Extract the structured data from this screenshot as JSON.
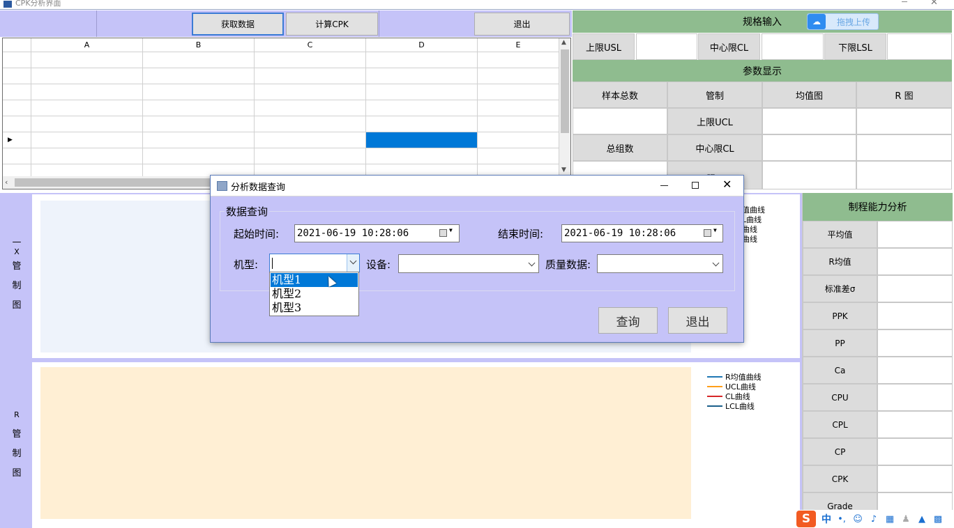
{
  "window": {
    "title": "CPK分析界面"
  },
  "toolbar": {
    "get_data": "获取数据",
    "calc_cpk": "计算CPK",
    "exit": "退出"
  },
  "grid": {
    "columns": [
      "A",
      "B",
      "C",
      "D",
      "E"
    ],
    "row_marker": "▸"
  },
  "spec": {
    "title": "规格输入",
    "upload": "拖拽上传",
    "usl": "上限USL",
    "cl": "中心限CL",
    "lsl": "下限LSL"
  },
  "params": {
    "title": "参数显示",
    "sample_total": "样本总数",
    "control": "管制",
    "mean_chart": "均值图",
    "r_chart": "R 图",
    "ucl": "上限UCL",
    "total_groups": "总组数",
    "cl": "中心限CL",
    "lcl": "下限LCL"
  },
  "capability": {
    "title": "制程能力分析",
    "items": [
      "平均值",
      "R均值",
      "标准差σ",
      "PPK",
      "PP",
      "Ca",
      "CPU",
      "CPL",
      "CP",
      "CPK",
      "Grade"
    ]
  },
  "xchart": {
    "label_chars": [
      "—",
      "X",
      "管",
      "制",
      "图"
    ],
    "legend": [
      "值曲线",
      "L曲线",
      "曲线",
      "曲线"
    ]
  },
  "rchart": {
    "label_chars": [
      "R",
      "管",
      "制",
      "图"
    ],
    "legend": [
      "R均值曲线",
      "UCL曲线",
      "CL曲线",
      "LCL曲线"
    ],
    "legend_colors": [
      "#1f77b4",
      "#ff9f1a",
      "#d62728",
      "#1a5f8a"
    ]
  },
  "dialog": {
    "title": "分析数据查询",
    "group": "数据查询",
    "start_label": "起始时间:",
    "start_value": "2021-06-19   10:28:06",
    "end_label": "结束时间:",
    "end_value": "2021-06-19   10:28:06",
    "model_label": "机型:",
    "device_label": "设备:",
    "quality_label": "质量数据:",
    "query": "查询",
    "exit": "退出",
    "model_options": [
      "机型1",
      "机型2",
      "机型3"
    ]
  },
  "ime": {
    "logo": "S",
    "lang": "中"
  }
}
